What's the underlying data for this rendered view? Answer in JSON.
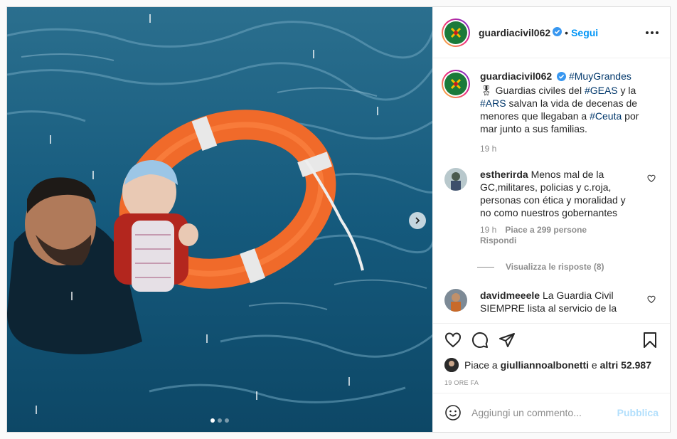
{
  "post": {
    "author": {
      "username": "guardiacivil062",
      "verified": true,
      "follow_label": "Segui",
      "separator": "•"
    },
    "caption": {
      "username": "guardiacivil062",
      "parts": [
        {
          "text": "#MuyGrandes",
          "tag": true
        },
        {
          "text": "🎖",
          "tag": false
        },
        {
          "text": " Guardias civiles del ",
          "tag": false
        },
        {
          "text": "#GEAS",
          "tag": true
        },
        {
          "text": " y la ",
          "tag": false
        },
        {
          "text": "#ARS",
          "tag": true
        },
        {
          "text": " salvan la vida de decenas de menores que llegaban a ",
          "tag": false
        },
        {
          "text": "#Ceuta",
          "tag": true
        },
        {
          "text": " por mar junto a sus familias.",
          "tag": false
        }
      ],
      "time": "19 h"
    },
    "comments": [
      {
        "username": "estherirda",
        "text": "Menos mal de la GC,militares, policias y c.roja, personas con ética y moralidad y no como nuestros gobernantes",
        "time": "19 h",
        "likes": "Piace a 299 persone",
        "reply_label": "Rispondi",
        "view_replies": "Visualizza le risposte (8)"
      },
      {
        "username": "davidmeeele",
        "text": "La Guardia Civil SIEMPRE lista al servicio de la"
      }
    ],
    "likes": {
      "prefix": "Piace a ",
      "user": "giulliannoalbonetti",
      "middle": " e ",
      "others": "altri 52.987"
    },
    "date": "19 ORE FA",
    "add_comment": {
      "placeholder": "Aggiungi un commento...",
      "publish_label": "Pubblica"
    },
    "carousel": {
      "slides": 3,
      "current": 1
    }
  },
  "icons": {
    "more": "more-options-icon",
    "verified": "verified-badge-icon",
    "like": "heart-icon",
    "comment": "comment-icon",
    "share": "share-icon",
    "save": "bookmark-icon",
    "emoji": "emoji-icon",
    "next": "chevron-right-icon"
  },
  "colors": {
    "accent": "#0095f6",
    "publish_disabled": "#b2dffc",
    "hashtag": "#00376b",
    "secondary_text": "#8e8e8e"
  }
}
